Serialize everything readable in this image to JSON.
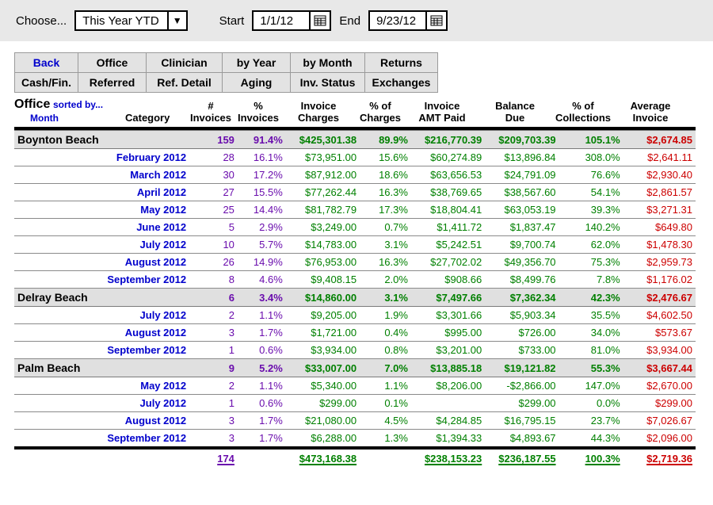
{
  "filter": {
    "choose_label": "Choose...",
    "preset": "This Year YTD",
    "start_label": "Start",
    "start_value": "1/1/12",
    "end_label": "End",
    "end_value": "9/23/12"
  },
  "tabs": {
    "r1": [
      "Back",
      "Office",
      "Clinician",
      "by Year",
      "by Month",
      "Returns"
    ],
    "r2": [
      "Cash/Fin.",
      "Referred",
      "Ref. Detail",
      "Aging",
      "Inv. Status",
      "Exchanges"
    ]
  },
  "header": {
    "office": "Office",
    "sorted1": "sorted by...",
    "sorted2": "Month",
    "category": "Category",
    "num_inv_1": "#",
    "num_inv_2": "Invoices",
    "pct_inv_1": "%",
    "pct_inv_2": "Invoices",
    "charges_1": "Invoice",
    "charges_2": "Charges",
    "pctchg_1": "% of",
    "pctchg_2": "Charges",
    "paid_1": "Invoice",
    "paid_2": "AMT Paid",
    "bal_1": "Balance",
    "bal_2": "Due",
    "pctcol_1": "% of",
    "pctcol_2": "Collections",
    "avg_1": "Average",
    "avg_2": "Invoice"
  },
  "groups": [
    {
      "name": "Boynton Beach",
      "sum": {
        "numinv": "159",
        "pctinv": "91.4%",
        "charges": "$425,301.38",
        "pctchg": "89.9%",
        "paid": "$216,770.39",
        "bal": "$209,703.39",
        "pctcol": "105.1%",
        "avg": "$2,674.85"
      },
      "rows": [
        {
          "month": "February 2012",
          "numinv": "28",
          "pctinv": "16.1%",
          "charges": "$73,951.00",
          "pctchg": "15.6%",
          "paid": "$60,274.89",
          "bal": "$13,896.84",
          "pctcol": "308.0%",
          "avg": "$2,641.11"
        },
        {
          "month": "March 2012",
          "numinv": "30",
          "pctinv": "17.2%",
          "charges": "$87,912.00",
          "pctchg": "18.6%",
          "paid": "$63,656.53",
          "bal": "$24,791.09",
          "pctcol": "76.6%",
          "avg": "$2,930.40"
        },
        {
          "month": "April 2012",
          "numinv": "27",
          "pctinv": "15.5%",
          "charges": "$77,262.44",
          "pctchg": "16.3%",
          "paid": "$38,769.65",
          "bal": "$38,567.60",
          "pctcol": "54.1%",
          "avg": "$2,861.57"
        },
        {
          "month": "May 2012",
          "numinv": "25",
          "pctinv": "14.4%",
          "charges": "$81,782.79",
          "pctchg": "17.3%",
          "paid": "$18,804.41",
          "bal": "$63,053.19",
          "pctcol": "39.3%",
          "avg": "$3,271.31"
        },
        {
          "month": "June 2012",
          "numinv": "5",
          "pctinv": "2.9%",
          "charges": "$3,249.00",
          "pctchg": "0.7%",
          "paid": "$1,411.72",
          "bal": "$1,837.47",
          "pctcol": "140.2%",
          "avg": "$649.80"
        },
        {
          "month": "July 2012",
          "numinv": "10",
          "pctinv": "5.7%",
          "charges": "$14,783.00",
          "pctchg": "3.1%",
          "paid": "$5,242.51",
          "bal": "$9,700.74",
          "pctcol": "62.0%",
          "avg": "$1,478.30"
        },
        {
          "month": "August 2012",
          "numinv": "26",
          "pctinv": "14.9%",
          "charges": "$76,953.00",
          "pctchg": "16.3%",
          "paid": "$27,702.02",
          "bal": "$49,356.70",
          "pctcol": "75.3%",
          "avg": "$2,959.73"
        },
        {
          "month": "September 2012",
          "numinv": "8",
          "pctinv": "4.6%",
          "charges": "$9,408.15",
          "pctchg": "2.0%",
          "paid": "$908.66",
          "bal": "$8,499.76",
          "pctcol": "7.8%",
          "avg": "$1,176.02"
        }
      ]
    },
    {
      "name": "Delray Beach",
      "sum": {
        "numinv": "6",
        "pctinv": "3.4%",
        "charges": "$14,860.00",
        "pctchg": "3.1%",
        "paid": "$7,497.66",
        "bal": "$7,362.34",
        "pctcol": "42.3%",
        "avg": "$2,476.67"
      },
      "rows": [
        {
          "month": "July 2012",
          "numinv": "2",
          "pctinv": "1.1%",
          "charges": "$9,205.00",
          "pctchg": "1.9%",
          "paid": "$3,301.66",
          "bal": "$5,903.34",
          "pctcol": "35.5%",
          "avg": "$4,602.50"
        },
        {
          "month": "August 2012",
          "numinv": "3",
          "pctinv": "1.7%",
          "charges": "$1,721.00",
          "pctchg": "0.4%",
          "paid": "$995.00",
          "bal": "$726.00",
          "pctcol": "34.0%",
          "avg": "$573.67"
        },
        {
          "month": "September 2012",
          "numinv": "1",
          "pctinv": "0.6%",
          "charges": "$3,934.00",
          "pctchg": "0.8%",
          "paid": "$3,201.00",
          "bal": "$733.00",
          "pctcol": "81.0%",
          "avg": "$3,934.00"
        }
      ]
    },
    {
      "name": "Palm Beach",
      "sum": {
        "numinv": "9",
        "pctinv": "5.2%",
        "charges": "$33,007.00",
        "pctchg": "7.0%",
        "paid": "$13,885.18",
        "bal": "$19,121.82",
        "pctcol": "55.3%",
        "avg": "$3,667.44"
      },
      "rows": [
        {
          "month": "May 2012",
          "numinv": "2",
          "pctinv": "1.1%",
          "charges": "$5,340.00",
          "pctchg": "1.1%",
          "paid": "$8,206.00",
          "bal": "-$2,866.00",
          "pctcol": "147.0%",
          "avg": "$2,670.00"
        },
        {
          "month": "July 2012",
          "numinv": "1",
          "pctinv": "0.6%",
          "charges": "$299.00",
          "pctchg": "0.1%",
          "paid": "",
          "bal": "$299.00",
          "pctcol": "0.0%",
          "avg": "$299.00"
        },
        {
          "month": "August 2012",
          "numinv": "3",
          "pctinv": "1.7%",
          "charges": "$21,080.00",
          "pctchg": "4.5%",
          "paid": "$4,284.85",
          "bal": "$16,795.15",
          "pctcol": "23.7%",
          "avg": "$7,026.67"
        },
        {
          "month": "September 2012",
          "numinv": "3",
          "pctinv": "1.7%",
          "charges": "$6,288.00",
          "pctchg": "1.3%",
          "paid": "$1,394.33",
          "bal": "$4,893.67",
          "pctcol": "44.3%",
          "avg": "$2,096.00"
        }
      ]
    }
  ],
  "grand_total": {
    "numinv": "174",
    "charges": "$473,168.38",
    "paid": "$238,153.23",
    "bal": "$236,187.55",
    "pctcol": "100.3%",
    "avg": "$2,719.36"
  }
}
